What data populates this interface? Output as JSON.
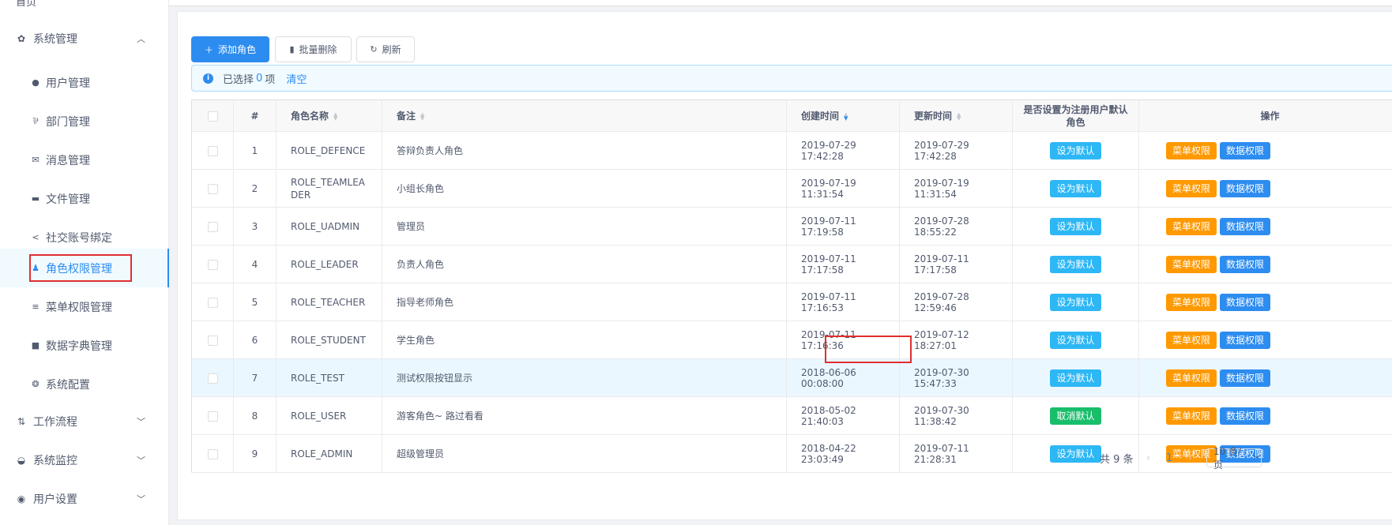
{
  "sidebar": {
    "top_partial": "首页",
    "groups": {
      "system": "系统管理",
      "workflow": "工作流程",
      "monitor": "系统监控",
      "user_settings": "用户设置"
    },
    "items": [
      {
        "label": "用户管理",
        "icon": "user-icon"
      },
      {
        "label": "部门管理",
        "icon": "department-icon"
      },
      {
        "label": "消息管理",
        "icon": "envelope-icon"
      },
      {
        "label": "文件管理",
        "icon": "folder-icon"
      },
      {
        "label": "社交账号绑定",
        "icon": "share-icon"
      },
      {
        "label": "角色权限管理",
        "icon": "users-icon"
      },
      {
        "label": "菜单权限管理",
        "icon": "menu-icon"
      },
      {
        "label": "数据字典管理",
        "icon": "book-icon"
      },
      {
        "label": "系统配置",
        "icon": "settings-icon"
      }
    ]
  },
  "toolbar": {
    "add_label": "添加角色",
    "batch_delete_label": "批量删除",
    "refresh_label": "刷新"
  },
  "selection": {
    "prefix": "已选择",
    "count": "0",
    "suffix": "项",
    "clear_label": "清空"
  },
  "table": {
    "headers": {
      "index": "#",
      "name": "角色名称",
      "description": "备注",
      "created": "创建时间",
      "updated": "更新时间",
      "default_line1": "是否设置为注册用户默认",
      "default_line2": "角色",
      "actions": "操作"
    },
    "set_default_label": "设为默认",
    "cancel_default_label": "取消默认",
    "menu_perm_label": "菜单权限",
    "data_perm_label": "数据权限",
    "rows": [
      {
        "index": "1",
        "name": "ROLE_DEFENCE",
        "description": "答辩负责人角色",
        "created": "2019-07-29 17:42:28",
        "updated": "2019-07-29 17:42:28",
        "is_default": false
      },
      {
        "index": "2",
        "name": "ROLE_TEAMLEADER",
        "description": "小组长角色",
        "created": "2019-07-19 11:31:54",
        "updated": "2019-07-19 11:31:54",
        "is_default": false
      },
      {
        "index": "3",
        "name": "ROLE_UADMIN",
        "description": "管理员",
        "created": "2019-07-11 17:19:58",
        "updated": "2019-07-28 18:55:22",
        "is_default": false
      },
      {
        "index": "4",
        "name": "ROLE_LEADER",
        "description": "负责人角色",
        "created": "2019-07-11 17:17:58",
        "updated": "2019-07-11 17:17:58",
        "is_default": false
      },
      {
        "index": "5",
        "name": "ROLE_TEACHER",
        "description": "指导老师角色",
        "created": "2019-07-11 17:16:53",
        "updated": "2019-07-28 12:59:46",
        "is_default": false
      },
      {
        "index": "6",
        "name": "ROLE_STUDENT",
        "description": "学生角色",
        "created": "2019-07-11 17:16:36",
        "updated": "2019-07-12 18:27:01",
        "is_default": false
      },
      {
        "index": "7",
        "name": "ROLE_TEST",
        "description": "测试权限按钮显示",
        "created": "2018-06-06 00:08:00",
        "updated": "2019-07-30 15:47:33",
        "is_default": false
      },
      {
        "index": "8",
        "name": "ROLE_USER",
        "description": "游客角色~ 路过看看",
        "created": "2018-05-02 21:40:03",
        "updated": "2019-07-30 11:38:42",
        "is_default": true
      },
      {
        "index": "9",
        "name": "ROLE_ADMIN",
        "description": "超级管理员",
        "created": "2018-04-22 23:03:49",
        "updated": "2019-07-11 21:28:31",
        "is_default": false
      }
    ]
  },
  "pagination": {
    "total_text": "共 9 条",
    "current_page": "1",
    "page_size": "10 条/页"
  },
  "colors": {
    "primary": "#2d8cf0",
    "info": "#2db7f5",
    "success": "#19be6b",
    "warning": "#ff9900",
    "annotation_red": "#e02f2f"
  }
}
